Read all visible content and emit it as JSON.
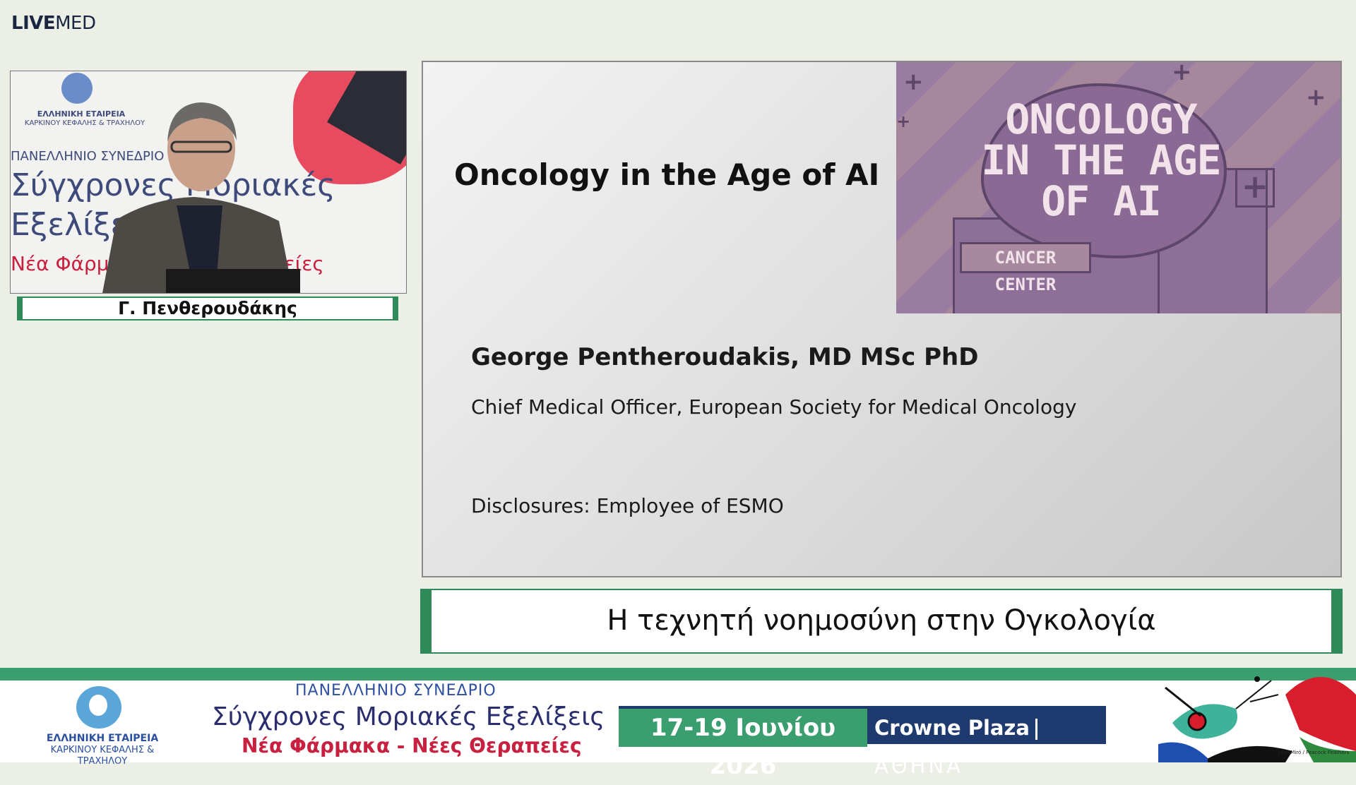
{
  "header": {
    "logo_bold": "LIVE",
    "logo_light": "MED"
  },
  "video": {
    "backdrop_org_line1": "ΕΛΛΗΝΙΚΗ ΕΤΑΙΡΕΙΑ",
    "backdrop_org_line2": "ΚΑΡΚΙΝΟΥ ΚΕΦΑΛΗΣ & ΤΡΑΧΗΛΟΥ",
    "backdrop_conf": "ΠΑΝΕΛΛΗΝΙΟ ΣΥΝΕΔΡΙΟ",
    "backdrop_line1": "Σύγχρονες Μοριακές",
    "backdrop_line2": "Εξελίξεις",
    "backdrop_line3": "Νέα Φάρμακα - Νέες Θεραπείες",
    "speaker_label": "Γ. Πενθερουδάκης"
  },
  "slide": {
    "title": "Oncology in the Age of AI",
    "speaker": "George Pentheroudakis, MD MSc PhD",
    "role": "Chief Medical Officer, European Society for Medical Oncology",
    "disclosures": "Disclosures: Employee of ESMO",
    "poster": {
      "cloud_line1": "ONCOLOGY",
      "cloud_line2": "IN THE AGE",
      "cloud_line3": "OF AI",
      "sign": "CANCER CENTER"
    }
  },
  "talk_title": "Η τεχνητή νοημοσύνη στην Ογκολογία",
  "footer": {
    "org_line1": "ΕΛΛΗΝΙΚΗ ΕΤΑΙΡΕΙΑ",
    "org_line2": "ΚΑΡΚΙΝΟΥ ΚΕΦΑΛΗΣ & ΤΡΑΧΗΛΟΥ",
    "conf_label": "ΠΑΝΕΛΛΗΝΙΟ ΣΥΝΕΔΡΙΟ",
    "conf_title": "Σύγχρονες Μοριακές Εξελίξεις",
    "conf_subtitle": "Νέα Φάρμακα - Νέες Θεραπείες",
    "dates": "17-19 Ιουνίου 2026",
    "venue": "Crowne Plaza",
    "city": "ΑΘΗΝΑ",
    "art_credit": "Joan Miró / Peacock Feathers"
  },
  "colors": {
    "accent_green": "#3a9e6e",
    "navy": "#1f3a6e",
    "conf_red": "#c8203f",
    "background": "#ecefe5"
  }
}
